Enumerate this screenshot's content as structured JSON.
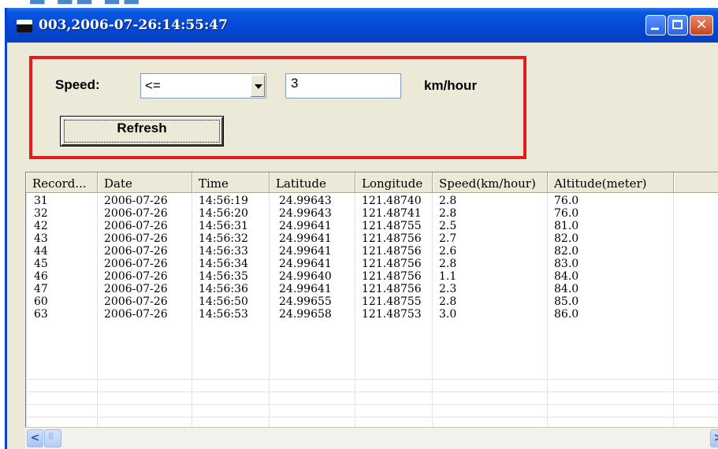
{
  "window": {
    "title": "003,2006-07-26:14:55:47",
    "close_glyph": "✕"
  },
  "filter": {
    "speed_label": "Speed:",
    "operator_selected": "<=",
    "speed_value": "3",
    "unit_label": "km/hour",
    "refresh_label": "Refresh"
  },
  "table": {
    "columns": [
      "Record...",
      "Date",
      "Time",
      "Latitude",
      "Longitude",
      "Speed(km/hour)",
      "Altitude(meter)"
    ],
    "rows": [
      [
        "31",
        "2006-07-26",
        "14:56:19",
        "24.99643",
        "121.48740",
        "2.8",
        "76.0"
      ],
      [
        "32",
        "2006-07-26",
        "14:56:20",
        "24.99643",
        "121.48741",
        "2.8",
        "76.0"
      ],
      [
        "42",
        "2006-07-26",
        "14:56:31",
        "24.99641",
        "121.48755",
        "2.5",
        "81.0"
      ],
      [
        "43",
        "2006-07-26",
        "14:56:32",
        "24.99641",
        "121.48756",
        "2.7",
        "82.0"
      ],
      [
        "44",
        "2006-07-26",
        "14:56:33",
        "24.99641",
        "121.48756",
        "2.6",
        "82.0"
      ],
      [
        "45",
        "2006-07-26",
        "14:56:34",
        "24.99641",
        "121.48756",
        "2.8",
        "83.0"
      ],
      [
        "46",
        "2006-07-26",
        "14:56:35",
        "24.99640",
        "121.48756",
        "1.1",
        "84.0"
      ],
      [
        "47",
        "2006-07-26",
        "14:56:36",
        "24.99641",
        "121.48756",
        "2.3",
        "84.0"
      ],
      [
        "60",
        "2006-07-26",
        "14:56:50",
        "24.99655",
        "121.48755",
        "2.8",
        "85.0"
      ],
      [
        "63",
        "2006-07-26",
        "14:56:53",
        "24.99658",
        "121.48753",
        "3.0",
        "86.0"
      ]
    ]
  },
  "colors": {
    "titlebar": "#0549d6",
    "highlight_border": "#e8191b",
    "window_bg": "#ece9d8"
  },
  "icons": {
    "minimize": "minimize-icon",
    "maximize": "maximize-icon",
    "close": "close-icon",
    "dropdown": "chevron-down-icon",
    "scroll_left": "arrow-left-icon",
    "scroll_right": "arrow-right-icon"
  }
}
